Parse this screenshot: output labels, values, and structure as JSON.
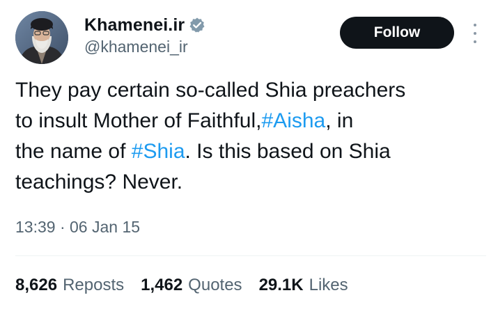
{
  "author": {
    "display_name": "Khamenei.ir",
    "handle": "@khamenei_ir",
    "avatar_icon": "portrait-avatar",
    "verified_icon": "verified-badge-icon",
    "verified_color": "#829aab"
  },
  "actions": {
    "follow_label": "Follow",
    "more_icon": "more-vertical-icon"
  },
  "tweet": {
    "line1": "They pay certain so-called Shia preachers",
    "line2_pre": "to insult Mother of Faithful,",
    "hashtag1": "#Aisha",
    "line2_post": ", in",
    "line3_pre": "the name of ",
    "hashtag2": "#Shia",
    "line3_post": ". Is this based on Shia",
    "line4": "teachings? Never."
  },
  "timestamp": "13:39 · 06 Jan 15",
  "stats": {
    "reposts_count": "8,626",
    "reposts_label": "Reposts",
    "quotes_count": "1,462",
    "quotes_label": "Quotes",
    "likes_count": "29.1K",
    "likes_label": "Likes"
  },
  "colors": {
    "text": "#0f1419",
    "secondary": "#536471",
    "hashtag": "#1d9bf0",
    "follow_bg": "#0f1419"
  }
}
